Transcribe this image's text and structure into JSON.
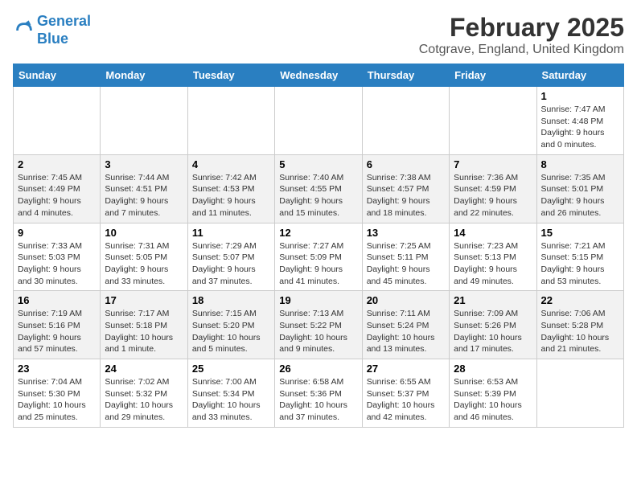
{
  "header": {
    "logo_line1": "General",
    "logo_line2": "Blue",
    "main_title": "February 2025",
    "subtitle": "Cotgrave, England, United Kingdom"
  },
  "calendar": {
    "days_of_week": [
      "Sunday",
      "Monday",
      "Tuesday",
      "Wednesday",
      "Thursday",
      "Friday",
      "Saturday"
    ],
    "weeks": [
      [
        {
          "day": "",
          "info": ""
        },
        {
          "day": "",
          "info": ""
        },
        {
          "day": "",
          "info": ""
        },
        {
          "day": "",
          "info": ""
        },
        {
          "day": "",
          "info": ""
        },
        {
          "day": "",
          "info": ""
        },
        {
          "day": "1",
          "info": "Sunrise: 7:47 AM\nSunset: 4:48 PM\nDaylight: 9 hours and 0 minutes."
        }
      ],
      [
        {
          "day": "2",
          "info": "Sunrise: 7:45 AM\nSunset: 4:49 PM\nDaylight: 9 hours and 4 minutes."
        },
        {
          "day": "3",
          "info": "Sunrise: 7:44 AM\nSunset: 4:51 PM\nDaylight: 9 hours and 7 minutes."
        },
        {
          "day": "4",
          "info": "Sunrise: 7:42 AM\nSunset: 4:53 PM\nDaylight: 9 hours and 11 minutes."
        },
        {
          "day": "5",
          "info": "Sunrise: 7:40 AM\nSunset: 4:55 PM\nDaylight: 9 hours and 15 minutes."
        },
        {
          "day": "6",
          "info": "Sunrise: 7:38 AM\nSunset: 4:57 PM\nDaylight: 9 hours and 18 minutes."
        },
        {
          "day": "7",
          "info": "Sunrise: 7:36 AM\nSunset: 4:59 PM\nDaylight: 9 hours and 22 minutes."
        },
        {
          "day": "8",
          "info": "Sunrise: 7:35 AM\nSunset: 5:01 PM\nDaylight: 9 hours and 26 minutes."
        }
      ],
      [
        {
          "day": "9",
          "info": "Sunrise: 7:33 AM\nSunset: 5:03 PM\nDaylight: 9 hours and 30 minutes."
        },
        {
          "day": "10",
          "info": "Sunrise: 7:31 AM\nSunset: 5:05 PM\nDaylight: 9 hours and 33 minutes."
        },
        {
          "day": "11",
          "info": "Sunrise: 7:29 AM\nSunset: 5:07 PM\nDaylight: 9 hours and 37 minutes."
        },
        {
          "day": "12",
          "info": "Sunrise: 7:27 AM\nSunset: 5:09 PM\nDaylight: 9 hours and 41 minutes."
        },
        {
          "day": "13",
          "info": "Sunrise: 7:25 AM\nSunset: 5:11 PM\nDaylight: 9 hours and 45 minutes."
        },
        {
          "day": "14",
          "info": "Sunrise: 7:23 AM\nSunset: 5:13 PM\nDaylight: 9 hours and 49 minutes."
        },
        {
          "day": "15",
          "info": "Sunrise: 7:21 AM\nSunset: 5:15 PM\nDaylight: 9 hours and 53 minutes."
        }
      ],
      [
        {
          "day": "16",
          "info": "Sunrise: 7:19 AM\nSunset: 5:16 PM\nDaylight: 9 hours and 57 minutes."
        },
        {
          "day": "17",
          "info": "Sunrise: 7:17 AM\nSunset: 5:18 PM\nDaylight: 10 hours and 1 minute."
        },
        {
          "day": "18",
          "info": "Sunrise: 7:15 AM\nSunset: 5:20 PM\nDaylight: 10 hours and 5 minutes."
        },
        {
          "day": "19",
          "info": "Sunrise: 7:13 AM\nSunset: 5:22 PM\nDaylight: 10 hours and 9 minutes."
        },
        {
          "day": "20",
          "info": "Sunrise: 7:11 AM\nSunset: 5:24 PM\nDaylight: 10 hours and 13 minutes."
        },
        {
          "day": "21",
          "info": "Sunrise: 7:09 AM\nSunset: 5:26 PM\nDaylight: 10 hours and 17 minutes."
        },
        {
          "day": "22",
          "info": "Sunrise: 7:06 AM\nSunset: 5:28 PM\nDaylight: 10 hours and 21 minutes."
        }
      ],
      [
        {
          "day": "23",
          "info": "Sunrise: 7:04 AM\nSunset: 5:30 PM\nDaylight: 10 hours and 25 minutes."
        },
        {
          "day": "24",
          "info": "Sunrise: 7:02 AM\nSunset: 5:32 PM\nDaylight: 10 hours and 29 minutes."
        },
        {
          "day": "25",
          "info": "Sunrise: 7:00 AM\nSunset: 5:34 PM\nDaylight: 10 hours and 33 minutes."
        },
        {
          "day": "26",
          "info": "Sunrise: 6:58 AM\nSunset: 5:36 PM\nDaylight: 10 hours and 37 minutes."
        },
        {
          "day": "27",
          "info": "Sunrise: 6:55 AM\nSunset: 5:37 PM\nDaylight: 10 hours and 42 minutes."
        },
        {
          "day": "28",
          "info": "Sunrise: 6:53 AM\nSunset: 5:39 PM\nDaylight: 10 hours and 46 minutes."
        },
        {
          "day": "",
          "info": ""
        }
      ]
    ]
  }
}
